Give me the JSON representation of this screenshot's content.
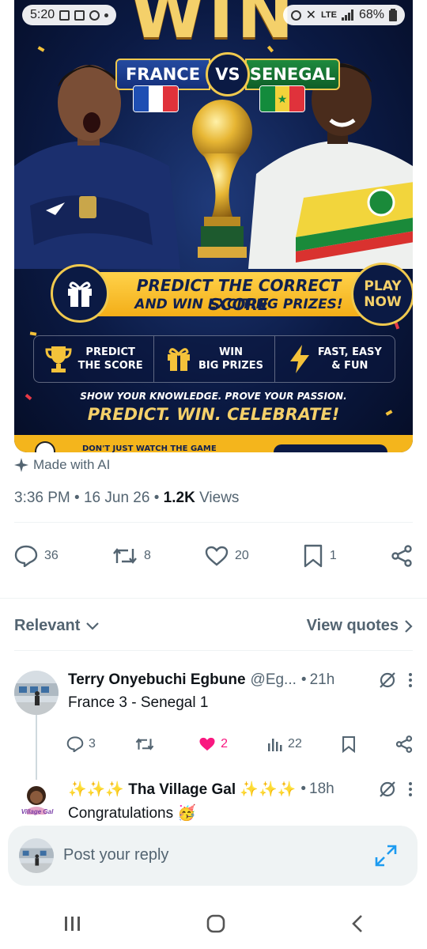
{
  "status_bar": {
    "time": "5:20",
    "network": "LTE",
    "battery": "68%"
  },
  "post_image": {
    "headline": "WIN",
    "team_left": "FRANCE",
    "versus": "VS",
    "team_right": "SENEGAL",
    "banner_line1": "PREDICT THE CORRECT SCORE",
    "banner_line2": "AND WIN EXCITING PRIZES!",
    "play_now_line1": "PLAY",
    "play_now_line2": "NOW",
    "features": [
      {
        "icon": "trophy-icon",
        "line1": "PREDICT",
        "line2": "THE SCORE"
      },
      {
        "icon": "gift-icon",
        "line1": "WIN",
        "line2": "BIG PRIZES"
      },
      {
        "icon": "lightning-icon",
        "line1": "FAST, EASY",
        "line2": "& FUN"
      }
    ],
    "tagline_small": "SHOW YOUR KNOWLEDGE. PROVE YOUR PASSION.",
    "tagline_big": "PREDICT. WIN. CELEBRATE!",
    "bottom_text": "DON'T JUST WATCH THE GAME"
  },
  "post": {
    "ai_label": "Made with AI",
    "time": "3:36 PM",
    "date": "16 Jun 26",
    "views_count": "1.2K",
    "views_label": "Views",
    "replies": "36",
    "reposts": "8",
    "likes": "20",
    "bookmarks": "1"
  },
  "sort": {
    "left": "Relevant",
    "right": "View quotes"
  },
  "replies": [
    {
      "name": "Terry Onyebuchi Egbune",
      "handle": "@Eg...",
      "time": "21h",
      "text": "France 3 - Senegal 1",
      "replies": "3",
      "reposts": "",
      "likes": "2",
      "views": "22"
    },
    {
      "name": "✨✨✨ Tha Village Gal ✨✨✨",
      "handle": "",
      "time": "18h",
      "text": "Congratulations 🥳",
      "avatar_text": "Village Gal"
    }
  ],
  "composer": {
    "placeholder": "Post your reply"
  },
  "colors": {
    "like_active": "#f91880",
    "muted": "#536471",
    "gold": "#f4d06a"
  }
}
